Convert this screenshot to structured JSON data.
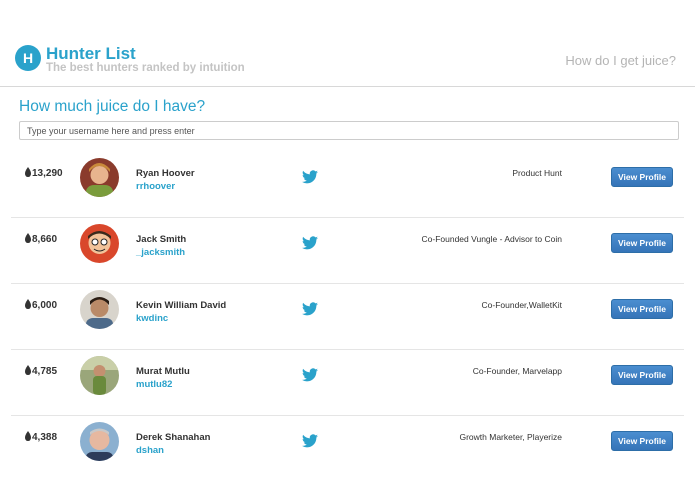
{
  "header": {
    "logo_letter": "H",
    "title": "Hunter List",
    "subtitle": "The best hunters ranked by intuition",
    "help_link": "How do I get juice?"
  },
  "search": {
    "title": "How much juice do I have?",
    "placeholder": "Type your username here and press enter"
  },
  "colors": {
    "accent": "#2aa2cb",
    "button": "#3a7cc0"
  },
  "hunters": [
    {
      "juice": "13,290",
      "name": "Ryan Hoover",
      "handle": "rrhoover",
      "bio": "Product Hunt",
      "button": "View Profile",
      "icon": "twitter-icon"
    },
    {
      "juice": "8,660",
      "name": "Jack Smith",
      "handle": "_jacksmith",
      "bio": "Co-Founded Vungle - Advisor to Coin",
      "button": "View Profile",
      "icon": "twitter-icon"
    },
    {
      "juice": "6,000",
      "name": "Kevin William David",
      "handle": "kwdinc",
      "bio": "Co-Founder,WalletKit",
      "button": "View Profile",
      "icon": "twitter-icon"
    },
    {
      "juice": "4,785",
      "name": "Murat Mutlu",
      "handle": "mutlu82",
      "bio": "Co-Founder, Marvelapp",
      "button": "View Profile",
      "icon": "twitter-icon"
    },
    {
      "juice": "4,388",
      "name": "Derek Shanahan",
      "handle": "dshan",
      "bio": "Growth Marketer, Playerize",
      "button": "View Profile",
      "icon": "twitter-icon"
    }
  ]
}
